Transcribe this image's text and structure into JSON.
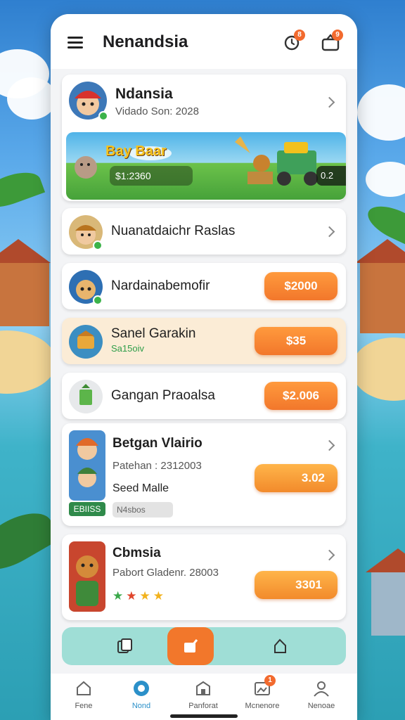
{
  "header": {
    "title": "Nenandsia",
    "badge_left": "8",
    "badge_right": "9"
  },
  "profile": {
    "name": "Ndansia",
    "subtitle": "Vidado Son: 2028"
  },
  "banner": {
    "title": "Bay Baar",
    "amount": "$1:2360",
    "right_value": "0.2"
  },
  "rows": [
    {
      "name": "Nuanatdaichr Raslas"
    },
    {
      "name": "Nardainabemofir",
      "price": "$2000"
    },
    {
      "name": "Sanel Garakin",
      "sub": "Sa15oiv",
      "price": "$35"
    },
    {
      "name": "Gangan Praoalsa",
      "price": "$2.006"
    }
  ],
  "feature1": {
    "name": "Betgan Vlairio",
    "subtitle": "Patehan : 2312003",
    "tag": "Seed Malle",
    "badge": "EBIISS",
    "chip": "N4sbos",
    "price": "3.02"
  },
  "feature2": {
    "name": "Cbmsia",
    "subtitle": "Pabort Gladenr. 28003",
    "price": "3301",
    "rating": 4
  },
  "nav": [
    {
      "label": "Fene"
    },
    {
      "label": "Nond"
    },
    {
      "label": "Panforat"
    },
    {
      "label": "Mcnenore",
      "badge": "1"
    },
    {
      "label": "Nenoae"
    }
  ],
  "colors": {
    "accent": "#f2772b",
    "active_tab": "#2b90c9",
    "tab_bar": "#9fded6",
    "sand_card": "#fbecd6"
  }
}
